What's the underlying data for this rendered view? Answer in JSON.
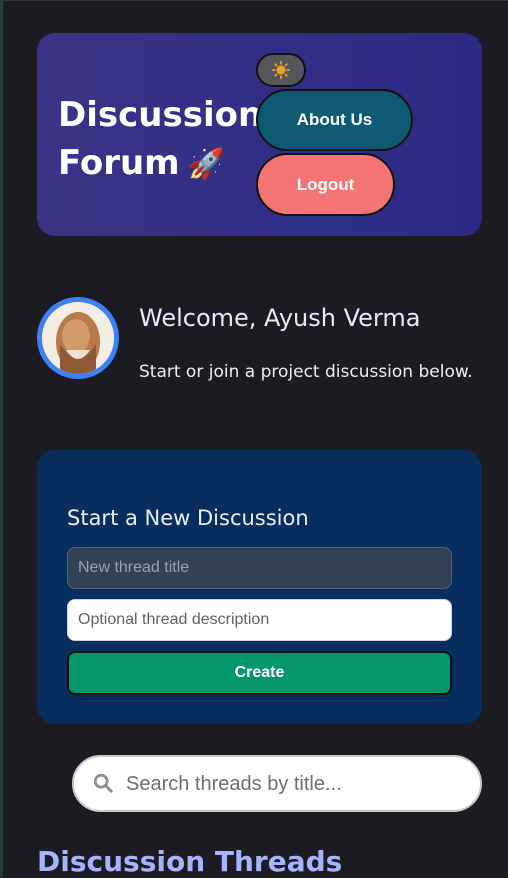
{
  "header": {
    "brand_line1": "Discussion",
    "brand_line2": "Forum",
    "brand_emoji": "🚀",
    "theme_toggle_icon": "sun-icon",
    "about_label": "About Us",
    "logout_label": "Logout"
  },
  "welcome": {
    "title": "Welcome, Ayush Verma",
    "subtitle": "Start or join a project discussion below."
  },
  "new_discussion": {
    "heading": "Start a New Discussion",
    "title_placeholder": "New thread title",
    "title_value": "",
    "description_placeholder": "Optional thread description",
    "description_value": "",
    "create_label": "Create"
  },
  "search": {
    "placeholder": "Search threads by title...",
    "value": ""
  },
  "threads": {
    "heading": "Discussion Threads"
  },
  "colors": {
    "background": "#1c1b22",
    "header": "#312e86",
    "about_button": "#0e5a72",
    "logout_button": "#f57474",
    "card": "#072d5f",
    "create_button": "#069669",
    "accent_heading": "#a5b4fc",
    "avatar_ring": "#3b82f6"
  }
}
